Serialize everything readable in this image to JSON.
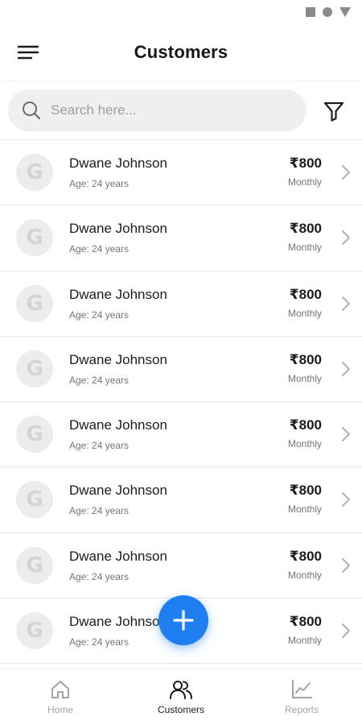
{
  "status_bar": {
    "icons": [
      "square-icon",
      "circle-icon",
      "triangle-icon"
    ]
  },
  "header": {
    "title": "Customers",
    "menu_icon": "menu-icon"
  },
  "search": {
    "placeholder": "Search here...",
    "value": "",
    "icon": "search-icon",
    "filter_icon": "filter-icon"
  },
  "customers": [
    {
      "initial": "G",
      "name": "Dwane Johnson",
      "age": "Age: 24 years",
      "price": "₹800",
      "frequency": "Monthly"
    },
    {
      "initial": "G",
      "name": "Dwane Johnson",
      "age": "Age: 24 years",
      "price": "₹800",
      "frequency": "Monthly"
    },
    {
      "initial": "G",
      "name": "Dwane Johnson",
      "age": "Age: 24 years",
      "price": "₹800",
      "frequency": "Monthly"
    },
    {
      "initial": "G",
      "name": "Dwane Johnson",
      "age": "Age: 24 years",
      "price": "₹800",
      "frequency": "Monthly"
    },
    {
      "initial": "G",
      "name": "Dwane Johnson",
      "age": "Age: 24 years",
      "price": "₹800",
      "frequency": "Monthly"
    },
    {
      "initial": "G",
      "name": "Dwane Johnson",
      "age": "Age: 24 years",
      "price": "₹800",
      "frequency": "Monthly"
    },
    {
      "initial": "G",
      "name": "Dwane Johnson",
      "age": "Age: 24 years",
      "price": "₹800",
      "frequency": "Monthly"
    },
    {
      "initial": "G",
      "name": "Dwane Johnson",
      "age": "Age: 24 years",
      "price": "₹800",
      "frequency": "Monthly"
    }
  ],
  "fab": {
    "icon": "plus-icon"
  },
  "bottom_nav": {
    "items": [
      {
        "label": "Home",
        "icon": "home-icon",
        "active": false
      },
      {
        "label": "Customers",
        "icon": "users-icon",
        "active": true
      },
      {
        "label": "Reports",
        "icon": "chart-icon",
        "active": false
      }
    ]
  },
  "colors": {
    "accent": "#1f7ff0",
    "inactive": "#a3a3a3",
    "text": "#1c1c1c"
  }
}
